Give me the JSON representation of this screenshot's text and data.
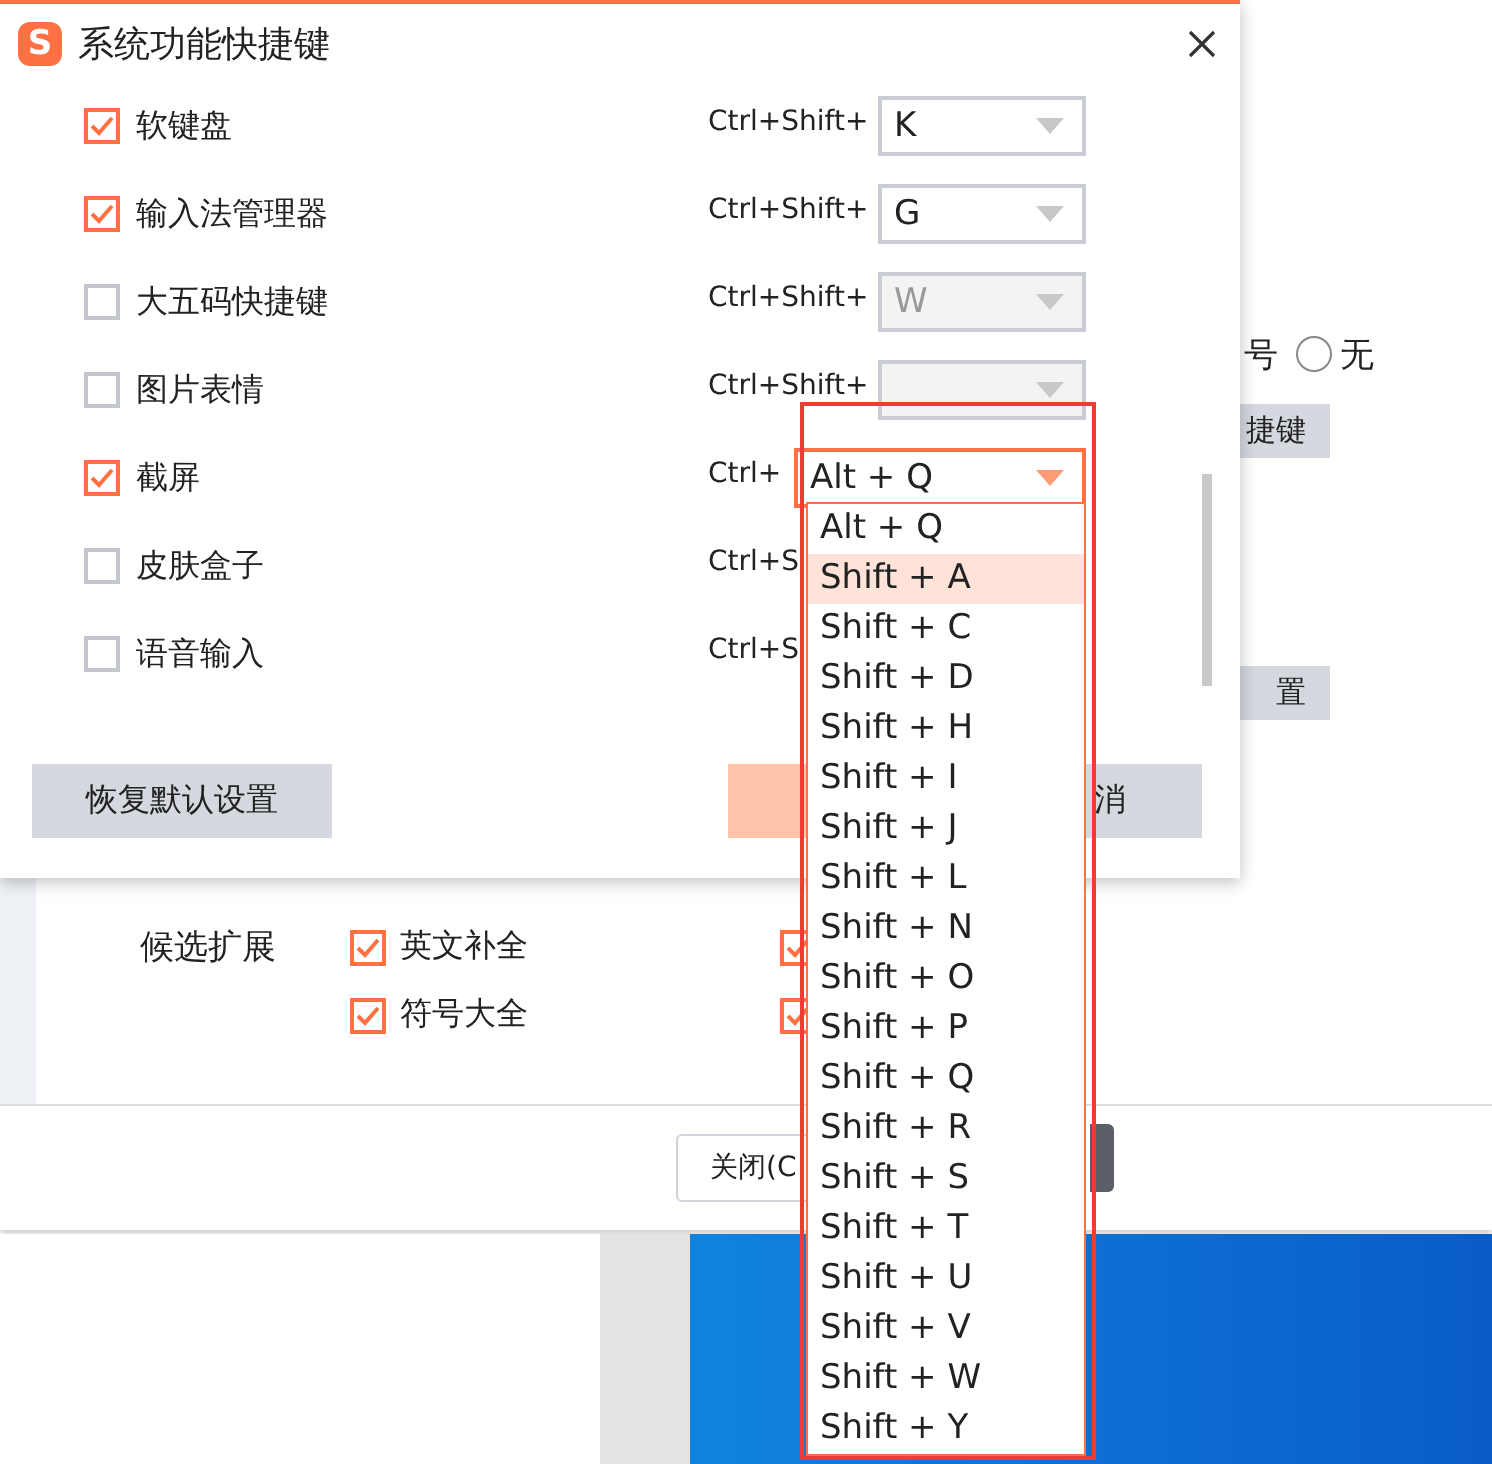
{
  "background": {
    "radio": {
      "fragment": "号",
      "label": "无",
      "selected": false
    },
    "side_buttons": [
      "捷键",
      "置"
    ],
    "candidates": {
      "label": "候选扩展",
      "options": [
        {
          "label": "英文补全",
          "checked": true
        },
        {
          "checked": true
        },
        {
          "label": "符号大全",
          "checked": true
        },
        {
          "checked": true
        }
      ]
    },
    "footer": {
      "close_button": "关闭(C"
    }
  },
  "dialog": {
    "logo": "S",
    "title": "系统功能快捷键",
    "shortcuts": [
      {
        "label": "软键盘",
        "checked": true,
        "prefix": "Ctrl+Shift+",
        "dropdown": {
          "value": "K",
          "disabled": false,
          "expanded": false
        }
      },
      {
        "label": "输入法管理器",
        "checked": true,
        "prefix": "Ctrl+Shift+",
        "dropdown": {
          "value": "G",
          "disabled": false,
          "expanded": false
        }
      },
      {
        "label": "大五码快捷键",
        "checked": false,
        "prefix": "Ctrl+Shift+",
        "dropdown": {
          "value": "W",
          "disabled": true,
          "expanded": false
        }
      },
      {
        "label": "图片表情",
        "checked": false,
        "prefix": "Ctrl+Shift+",
        "dropdown": {
          "disabled": true,
          "expanded": false
        }
      },
      {
        "label": "截屏",
        "checked": true,
        "prefix": "Ctrl+",
        "dropdown": {
          "value": "Alt + Q",
          "disabled": false,
          "expanded": true
        }
      },
      {
        "label": "皮肤盒子",
        "checked": false,
        "prefix": "Ctrl+S"
      },
      {
        "label": "语音输入",
        "checked": false,
        "prefix": "Ctrl+S"
      }
    ],
    "buttons": [
      {
        "kind": "secondary",
        "label": "恢复默认设置"
      },
      {
        "kind": "primary"
      },
      {
        "kind": "cancel",
        "label": "消"
      }
    ],
    "options": [
      {
        "label": "Alt + Q",
        "selected": false
      },
      {
        "label": "Shift + A",
        "selected": true
      },
      {
        "label": "Shift + C",
        "selected": false
      },
      {
        "label": "Shift + D",
        "selected": false
      },
      {
        "label": "Shift + H",
        "selected": false
      },
      {
        "label": "Shift + I",
        "selected": false
      },
      {
        "label": "Shift + J",
        "selected": false
      },
      {
        "label": "Shift + L",
        "selected": false
      },
      {
        "label": "Shift + N",
        "selected": false
      },
      {
        "label": "Shift + O",
        "selected": false
      },
      {
        "label": "Shift + P",
        "selected": false
      },
      {
        "label": "Shift + Q",
        "selected": false
      },
      {
        "label": "Shift + R",
        "selected": false
      },
      {
        "label": "Shift + S",
        "selected": false
      },
      {
        "label": "Shift + T",
        "selected": false
      },
      {
        "label": "Shift + U",
        "selected": false
      },
      {
        "label": "Shift + V",
        "selected": false
      },
      {
        "label": "Shift + W",
        "selected": false
      },
      {
        "label": "Shift + Y",
        "selected": false
      }
    ]
  }
}
